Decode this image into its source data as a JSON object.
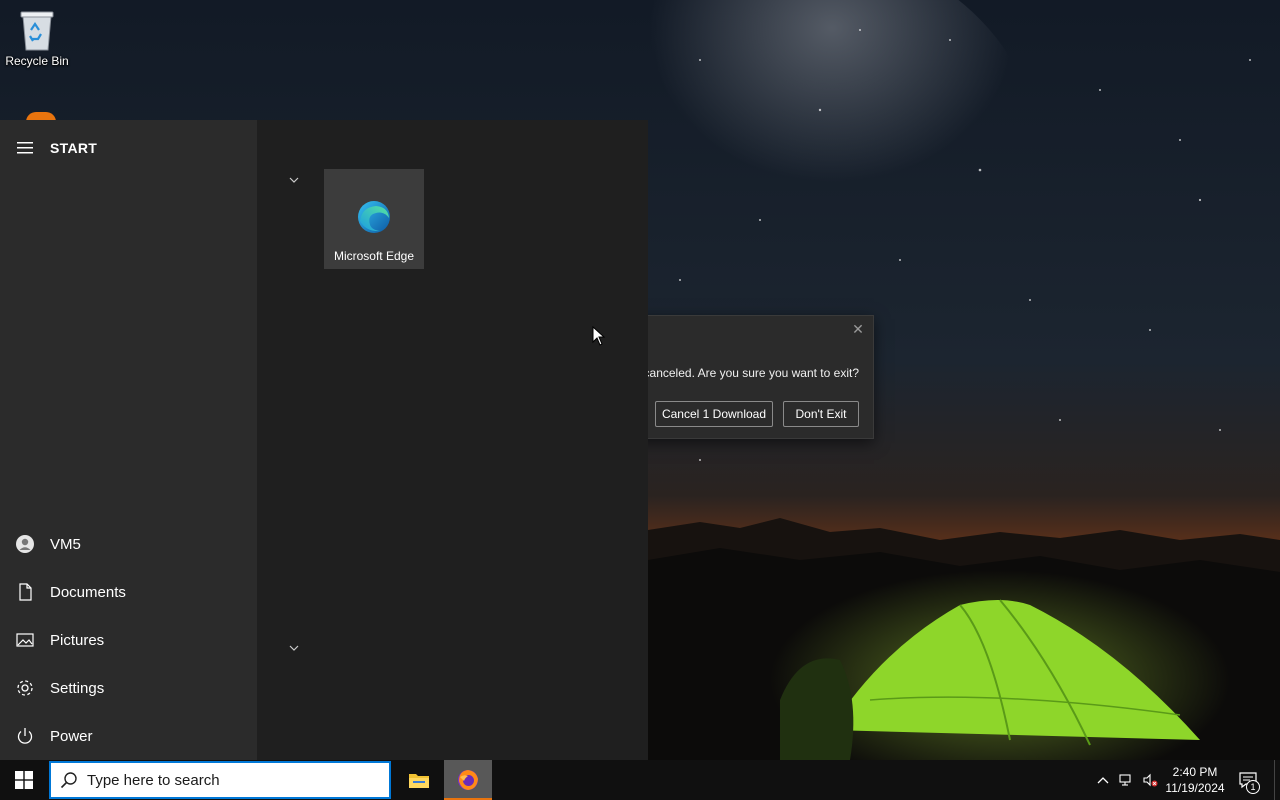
{
  "desktop": {
    "icons": [
      {
        "label": "Recycle Bin",
        "icon": "recycle-bin-icon"
      }
    ]
  },
  "dialog": {
    "message": "canceled. Are you sure you want to exit?",
    "buttons": {
      "cancel": "Cancel 1 Download",
      "dont_exit": "Don't Exit"
    },
    "close_glyph": "✕"
  },
  "start_menu": {
    "title": "START",
    "tiles": [
      {
        "label": "Microsoft Edge",
        "icon": "edge-icon"
      }
    ],
    "nav": [
      {
        "label": "VM5",
        "icon": "user-icon"
      },
      {
        "label": "Documents",
        "icon": "document-icon"
      },
      {
        "label": "Pictures",
        "icon": "pictures-icon"
      },
      {
        "label": "Settings",
        "icon": "gear-icon"
      },
      {
        "label": "Power",
        "icon": "power-icon"
      }
    ]
  },
  "taskbar": {
    "search": {
      "placeholder": "Type here to search"
    },
    "apps": [
      {
        "name": "File Explorer",
        "icon": "folder-icon",
        "active": false
      },
      {
        "name": "Firefox",
        "icon": "firefox-icon",
        "active": true
      }
    ],
    "clock": {
      "time": "2:40 PM",
      "date": "11/19/2024"
    },
    "notifications_count": "1"
  },
  "colors": {
    "accent": "#0078d7",
    "start_left_bg": "#2b2b2b",
    "start_right_bg": "#1f1f1f",
    "tile_bg": "#3c3c3c",
    "taskbar_bg": "#101010",
    "firefox_orange": "#e8740e"
  }
}
